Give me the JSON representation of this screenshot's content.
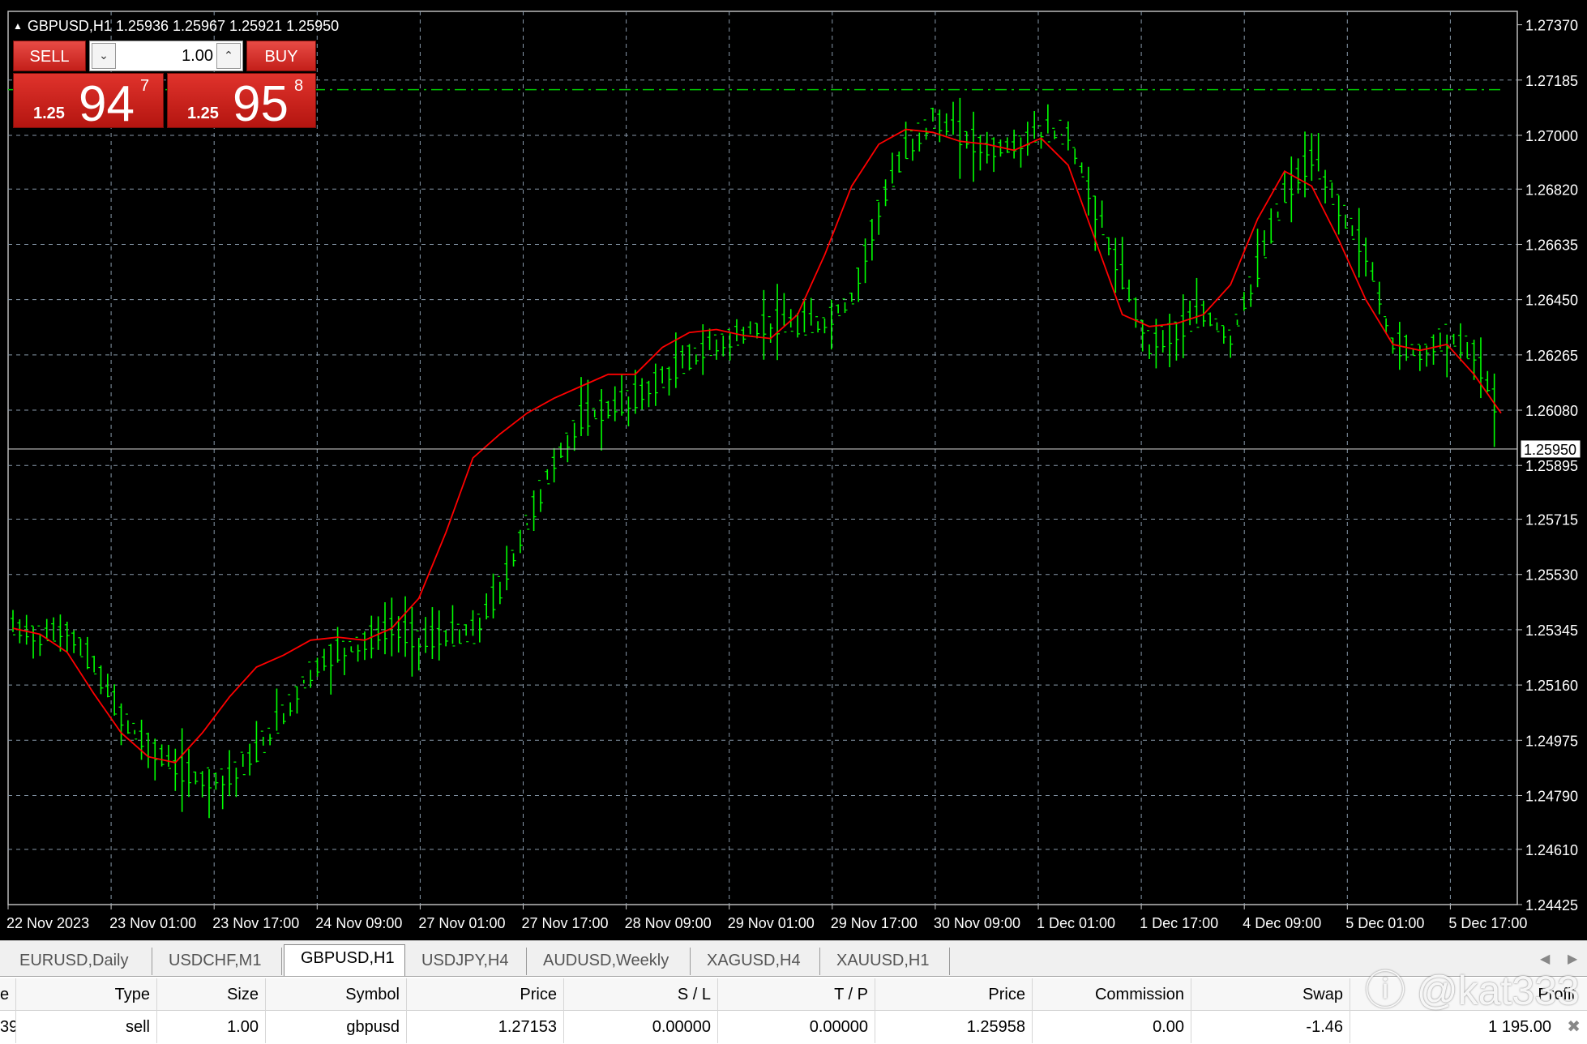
{
  "chart": {
    "title": "GBPUSD,H1  1.25936 1.25967 1.25921 1.25950",
    "current_price": "1.25950",
    "price_ticks": [
      "1.27370",
      "1.27185",
      "1.27000",
      "1.26820",
      "1.26635",
      "1.26450",
      "1.26265",
      "1.26080",
      "1.25895",
      "1.25715",
      "1.25530",
      "1.25345",
      "1.25160",
      "1.24975",
      "1.24790",
      "1.24610",
      "1.24425"
    ],
    "time_ticks": [
      "22 Nov 2023",
      "23 Nov 01:00",
      "23 Nov 17:00",
      "24 Nov 09:00",
      "27 Nov 01:00",
      "27 Nov 17:00",
      "28 Nov 09:00",
      "29 Nov 01:00",
      "29 Nov 17:00",
      "30 Nov 09:00",
      "1 Dec 01:00",
      "1 Dec 17:00",
      "4 Dec 09:00",
      "5 Dec 01:00",
      "5 Dec 17:00"
    ],
    "colors": {
      "background": "#000000",
      "bars": "#00ff00",
      "moving_average": "#ff0000",
      "grid": "#8899aa",
      "level_line": "#00cc00",
      "bid_line": "#c0c0c0"
    }
  },
  "chart_data": {
    "type": "line",
    "series": [
      {
        "values": [
          1.2535,
          1.2532,
          1.2534,
          1.2522,
          1.2505,
          1.2495,
          1.2488,
          1.2484,
          1.2485,
          1.2493,
          1.2506,
          1.252,
          1.2527,
          1.253,
          1.2535,
          1.2531,
          1.2532,
          1.2533,
          1.2548,
          1.257,
          1.259,
          1.2605,
          1.2608,
          1.2612,
          1.2618,
          1.2625,
          1.263,
          1.2633,
          1.2637,
          1.2636,
          1.2637,
          1.2645,
          1.2675,
          1.2695,
          1.2705,
          1.27,
          1.2695,
          1.2696,
          1.2701,
          1.27,
          1.2675,
          1.2652,
          1.263,
          1.2634,
          1.264,
          1.2632,
          1.2655,
          1.268,
          1.2692,
          1.2676,
          1.266,
          1.263,
          1.2627,
          1.2632,
          1.2627,
          1.2605
        ]
      },
      {
        "values": [
          1.2535,
          1.2533,
          1.2527,
          1.2513,
          1.25,
          1.2492,
          1.249,
          1.25,
          1.2512,
          1.2522,
          1.2526,
          1.2531,
          1.2532,
          1.2531,
          1.2535,
          1.2545,
          1.2567,
          1.2592,
          1.26,
          1.2607,
          1.2612,
          1.2616,
          1.262,
          1.262,
          1.2629,
          1.2634,
          1.2635,
          1.2633,
          1.2632,
          1.264,
          1.266,
          1.2683,
          1.2697,
          1.2702,
          1.2701,
          1.2698,
          1.2697,
          1.2695,
          1.2699,
          1.269,
          1.2665,
          1.264,
          1.2636,
          1.2637,
          1.264,
          1.265,
          1.2672,
          1.2688,
          1.2683,
          1.2665,
          1.2645,
          1.263,
          1.2628,
          1.263,
          1.262,
          1.2607
        ]
      }
    ],
    "ylim": [
      1.24425,
      1.27415
    ],
    "grid": true
  },
  "one_click": {
    "sell_label": "SELL",
    "buy_label": "BUY",
    "volume": "1.00",
    "sell_prefix": "1.25",
    "sell_big": "94",
    "sell_sup": "7",
    "buy_prefix": "1.25",
    "buy_big": "95",
    "buy_sup": "8"
  },
  "tabs": [
    "EURUSD,Daily",
    "USDCHF,M1",
    "GBPUSD,H1",
    "USDJPY,H4",
    "AUDUSD,Weekly",
    "XAGUSD,H4",
    "XAUUSD,H1"
  ],
  "orders": {
    "headers": [
      "e",
      "Type",
      "Size",
      "Symbol",
      "Price",
      "S / L",
      "T / P",
      "Price",
      "Commission",
      "Swap",
      "Profit"
    ],
    "row": [
      "39",
      "sell",
      "1.00",
      "gbpusd",
      "1.27153",
      "0.00000",
      "0.00000",
      "1.25958",
      "0.00",
      "-1.46",
      "1 195.00"
    ]
  },
  "watermark": "ⓘ @kat333"
}
